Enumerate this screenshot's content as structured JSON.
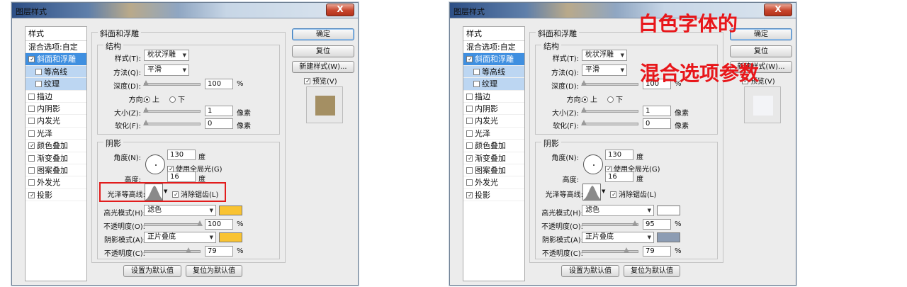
{
  "dialog_title": "图层样式",
  "close_symbol": "X",
  "styles_header": "样式",
  "blend_options": "混合选项:自定",
  "effects": {
    "bevel": "斜面和浮雕",
    "contour": "等高线",
    "texture": "纹理",
    "stroke": "描边",
    "inner_shadow": "内阴影",
    "inner_glow": "内发光",
    "satin": "光泽",
    "color_overlay": "颜色叠加",
    "gradient_overlay": "渐变叠加",
    "pattern_overlay": "图案叠加",
    "outer_glow": "外发光",
    "drop_shadow": "投影"
  },
  "bevel_title": "斜面和浮雕",
  "structure_title": "结构",
  "shading_title": "阴影",
  "labels": {
    "style": "样式(T):",
    "technique": "方法(Q):",
    "depth": "深度(D):",
    "direction": "方向:",
    "size": "大小(Z):",
    "soften": "软化(F):",
    "angle": "角度(N):",
    "global_light": "使用全局光(G)",
    "altitude": "高度:",
    "gloss_contour": "光泽等高线:",
    "anti_alias": "消除锯齿(L)",
    "highlight_mode": "高光模式(H):",
    "opacity": "不透明度(O):",
    "shadow_mode": "阴影模式(A):",
    "opacity2": "不透明度(C):",
    "up": "上",
    "down": "下"
  },
  "units": {
    "percent": "%",
    "pixel": "像素",
    "degree": "度"
  },
  "values": {
    "style": "枕状浮雕",
    "technique": "平滑",
    "depth": "100",
    "size": "1",
    "soften": "0",
    "angle": "130",
    "altitude": "16",
    "highlight_mode": "滤色",
    "shadow_mode": "正片叠底"
  },
  "left": {
    "highlight_opacity": "100",
    "shadow_opacity": "79",
    "highlight_color": "#f9c332",
    "shadow_color": "#f9c332",
    "preview_color": "#a48f63",
    "highlight_opacity_pct": 100,
    "shadow_opacity_pct": 79
  },
  "right": {
    "highlight_opacity": "95",
    "shadow_opacity": "79",
    "highlight_color": "#ffffff",
    "shadow_color": "#8c9cb3",
    "preview_color": "#f3f4f7",
    "highlight_opacity_pct": 95,
    "shadow_opacity_pct": 79
  },
  "buttons": {
    "ok": "确定",
    "reset": "复位",
    "new_style": "新建样式(W)...",
    "preview": "预览(V)",
    "set_default": "设置为默认值",
    "reset_default": "复位为默认值"
  },
  "annotation": {
    "line1": "白色字体的",
    "line2": "混合选项参数"
  }
}
